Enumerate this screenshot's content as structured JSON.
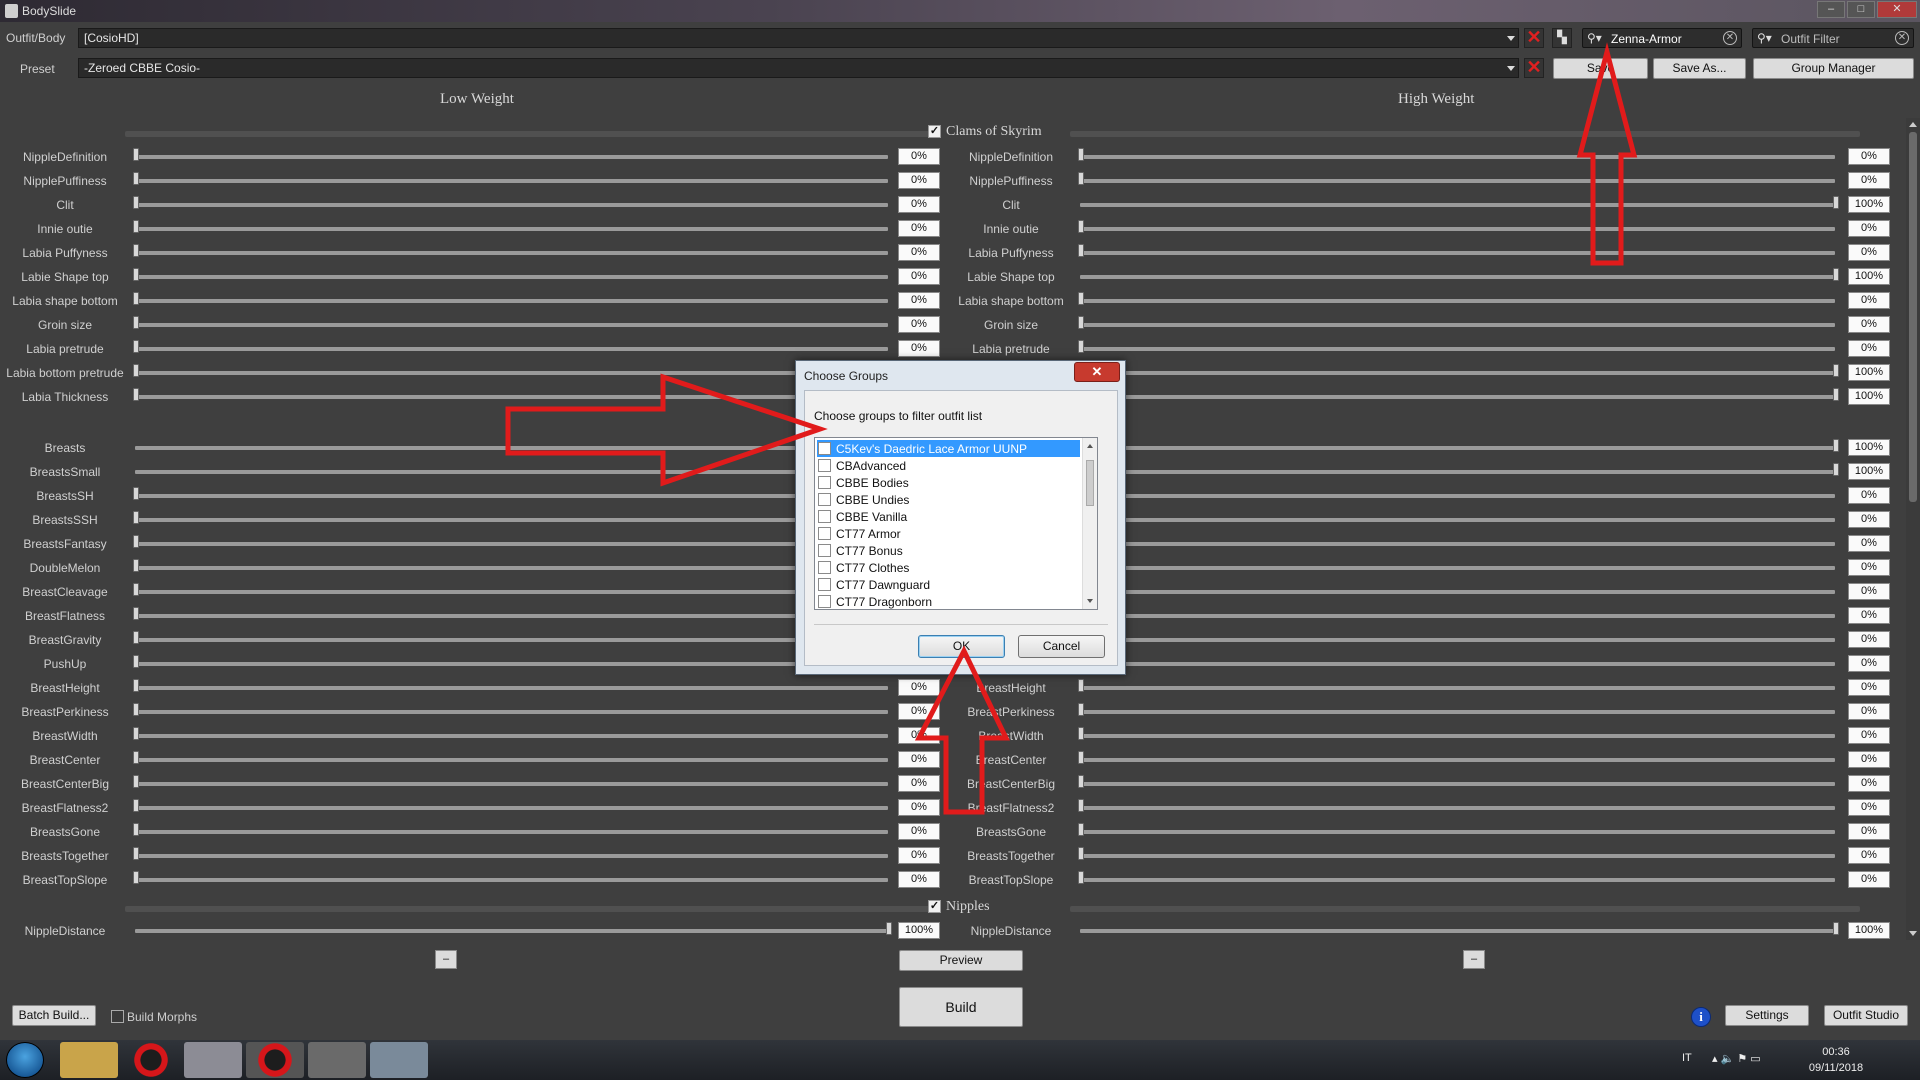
{
  "window": {
    "title": "BodySlide",
    "min": "–",
    "max": "□",
    "close": "✕"
  },
  "toolbar": {
    "outfit_label": "Outfit/Body",
    "outfit_value": "[CosioHD]",
    "preset_label": "Preset",
    "preset_value": "-Zeroed CBBE Cosio-",
    "group_filter_value": "Zenna-Armor",
    "outfit_filter_placeholder": "Outfit Filter",
    "save_label": "Save",
    "save_as_label": "Save As...",
    "group_manager_label": "Group Manager"
  },
  "columns": {
    "low": "Low Weight",
    "high": "High Weight"
  },
  "groups": {
    "clams": "Clams of Skyrim",
    "nipples": "Nipples"
  },
  "sliders_clams": [
    {
      "name": "NippleDefinition",
      "low": 0,
      "high": 0,
      "low_label": "0%",
      "high_label": "0%"
    },
    {
      "name": "NipplePuffiness",
      "low": 0,
      "high": 0,
      "low_label": "0%",
      "high_label": "0%"
    },
    {
      "name": "Clit",
      "low": 0,
      "high": 100,
      "low_label": "0%",
      "high_label": "100%"
    },
    {
      "name": "Innie outie",
      "low": 0,
      "high": 0,
      "low_label": "0%",
      "high_label": "0%"
    },
    {
      "name": "Labia Puffyness",
      "low": 0,
      "high": 0,
      "low_label": "0%",
      "high_label": "0%"
    },
    {
      "name": "Labie Shape top",
      "low": 0,
      "high": 100,
      "low_label": "0%",
      "high_label": "100%"
    },
    {
      "name": "Labia shape bottom",
      "low": 0,
      "high": 0,
      "low_label": "0%",
      "high_label": "0%"
    },
    {
      "name": "Groin size",
      "low": 0,
      "high": 0,
      "low_label": "0%",
      "high_label": "0%"
    },
    {
      "name": "Labia pretrude",
      "low": 0,
      "high": 0,
      "low_label": "0%",
      "high_label": "0%"
    },
    {
      "name": "Labia bottom pretrude",
      "low": 0,
      "high": 100,
      "low_label": "",
      "high_label": "100%"
    },
    {
      "name": "Labia Thickness",
      "low": 0,
      "high": 100,
      "low_label": "",
      "high_label": "100%"
    }
  ],
  "sliders_body": [
    {
      "name": "Breasts",
      "low": 100,
      "high": 100,
      "low_label": "",
      "high_label": "100%"
    },
    {
      "name": "BreastsSmall",
      "low": 100,
      "high": 100,
      "low_label": "",
      "high_label": "100%"
    },
    {
      "name": "BreastsSH",
      "low": 0,
      "high": 0,
      "low_label": "",
      "high_label": "0%"
    },
    {
      "name": "BreastsSSH",
      "low": 0,
      "high": 0,
      "low_label": "",
      "high_label": "0%"
    },
    {
      "name": "BreastsFantasy",
      "low": 0,
      "high": 0,
      "low_label": "",
      "high_label": "0%"
    },
    {
      "name": "DoubleMelon",
      "low": 0,
      "high": 0,
      "low_label": "",
      "high_label": "0%"
    },
    {
      "name": "BreastCleavage",
      "low": 0,
      "high": 0,
      "low_label": "",
      "high_label": "0%"
    },
    {
      "name": "BreastFlatness",
      "low": 0,
      "high": 0,
      "low_label": "",
      "high_label": "0%"
    },
    {
      "name": "BreastGravity",
      "low": 0,
      "high": 0,
      "low_label": "",
      "high_label": "0%"
    },
    {
      "name": "PushUp",
      "low": 0,
      "high": 0,
      "low_label": "",
      "high_label": "0%"
    },
    {
      "name": "BreastHeight",
      "low": 0,
      "high": 0,
      "low_label": "0%",
      "high_label": "0%"
    },
    {
      "name": "BreastPerkiness",
      "low": 0,
      "high": 0,
      "low_label": "0%",
      "high_label": "0%"
    },
    {
      "name": "BreastWidth",
      "low": 0,
      "high": 0,
      "low_label": "0%",
      "high_label": "0%"
    },
    {
      "name": "BreastCenter",
      "low": 0,
      "high": 0,
      "low_label": "0%",
      "high_label": "0%"
    },
    {
      "name": "BreastCenterBig",
      "low": 0,
      "high": 0,
      "low_label": "0%",
      "high_label": "0%"
    },
    {
      "name": "BreastFlatness2",
      "low": 0,
      "high": 0,
      "low_label": "0%",
      "high_label": "0%"
    },
    {
      "name": "BreastsGone",
      "low": 0,
      "high": 0,
      "low_label": "0%",
      "high_label": "0%"
    },
    {
      "name": "BreastsTogether",
      "low": 0,
      "high": 0,
      "low_label": "0%",
      "high_label": "0%"
    },
    {
      "name": "BreastTopSlope",
      "low": 0,
      "high": 0,
      "low_label": "0%",
      "high_label": "0%"
    }
  ],
  "sliders_nipples": [
    {
      "name": "NippleDistance",
      "low": 100,
      "high": 100,
      "low_label": "100%",
      "high_label": "100%"
    }
  ],
  "dialog": {
    "title": "Choose Groups",
    "close": "✕",
    "prompt": "Choose groups to filter outfit list",
    "items": [
      "C5Kev's Daedric Lace Armor UUNP",
      "CBAdvanced",
      "CBBE Bodies",
      "CBBE Undies",
      "CBBE Vanilla",
      "CT77 Armor",
      "CT77 Bonus",
      "CT77 Clothes",
      "CT77 Dawnguard",
      "CT77 Dragonborn"
    ],
    "selected_index": 0,
    "ok": "OK",
    "cancel": "Cancel"
  },
  "bottom": {
    "batch_build": "Batch Build...",
    "build_morphs": "Build Morphs",
    "preview": "Preview",
    "build": "Build",
    "settings": "Settings",
    "outfit_studio": "Outfit Studio",
    "minus": "–",
    "info": "i"
  },
  "taskbar": {
    "lang": "IT",
    "time": "00:36",
    "date": "09/11/2018"
  },
  "colors": {
    "background": "#3f3f3f",
    "annotation": "#e11b1b",
    "selection": "#3399ff"
  }
}
